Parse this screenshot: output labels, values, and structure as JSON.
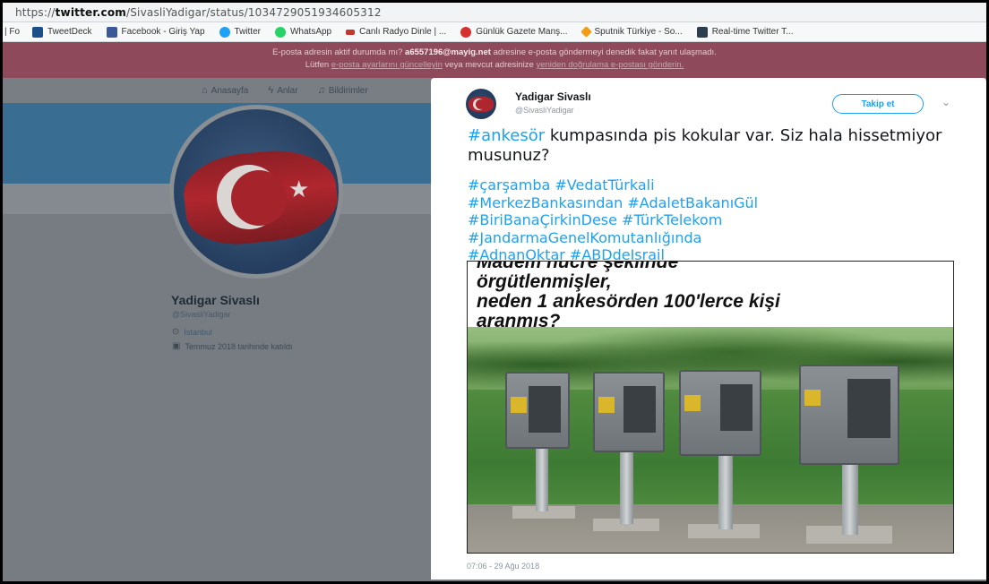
{
  "browser": {
    "url_prefix": "https://",
    "url_domain": "twitter.com",
    "url_path": "/SivasliYadigar/status/1034729051934605312",
    "bookmarks": [
      {
        "label": "TweetDeck",
        "icon": "tweetdeck-icon",
        "color": "#1b4f8a"
      },
      {
        "label": "Facebook - Giriş Yap",
        "icon": "facebook-icon",
        "color": "#3b5998"
      },
      {
        "label": "Twitter",
        "icon": "twitter-icon",
        "color": "#1da1f2"
      },
      {
        "label": "WhatsApp",
        "icon": "whatsapp-icon",
        "color": "#25d366"
      },
      {
        "label": "Canlı Radyo Dinle | ...",
        "icon": "radio-icon",
        "color": "#c0392b"
      },
      {
        "label": "Günlük Gazete Manş...",
        "icon": "newspaper-icon",
        "color": "#d63031"
      },
      {
        "label": "Sputnik Türkiye - So...",
        "icon": "sputnik-icon",
        "color": "#f39c12"
      },
      {
        "label": "Real-time Twitter T...",
        "icon": "realtime-icon",
        "color": "#2c3e50"
      }
    ]
  },
  "banner": {
    "line1_pre": "E-posta adresin aktif durumda mı?",
    "email": "a6557196@mayig.net",
    "line1_post": "adresine e-posta göndermeyi denedik fakat yanıt ulaşmadı.",
    "line2_pre": "Lütfen",
    "line2_link1": "e-posta ayarlarını güncelleyin",
    "line2_mid": "veya mevcut adresinize",
    "line2_link2": "yeniden doğrulama e-postası gönderin."
  },
  "nav": {
    "items": [
      {
        "label": "Anasayfa",
        "icon": "home-icon"
      },
      {
        "label": "Anlar",
        "icon": "lightning-icon"
      },
      {
        "label": "Bildirimler",
        "icon": "bell-icon"
      }
    ]
  },
  "profile": {
    "name": "Yadigar Sivaslı",
    "handle": "@SivasliYadigar",
    "location": "İstanbul",
    "joined": "Temmuz 2018 tarihinde katıldı"
  },
  "tweet": {
    "author_name": "Yadigar Sivaslı",
    "author_handle": "@SivasliYadigar",
    "follow_label": "Takip et",
    "text_hashtag": "#ankesör",
    "text_rest": " kumpasında pis kokular var. Siz hala hissetmiyor musunuz?",
    "hashtag_lines": [
      "#çarşamba #VedatTürkali",
      "#MerkezBankasından #AdaletBakanıGül",
      "#BiriBanaÇirkinDese #TürkTelekom",
      "#JandarmaGenelKomutanlığında",
      "#AdnanOktar #ABDdeIsrail"
    ],
    "image_caption": [
      "Madem hücre şeklinde",
      "örgütlenmişler,",
      "neden 1 ankesörden 100'lerce kişi",
      "aranmış?"
    ],
    "timestamp": "07:06 - 29 Ağu 2018"
  },
  "colors": {
    "accent": "#1da1f2",
    "banner": "#8e4a5b",
    "header_band": "#3a6d92"
  }
}
